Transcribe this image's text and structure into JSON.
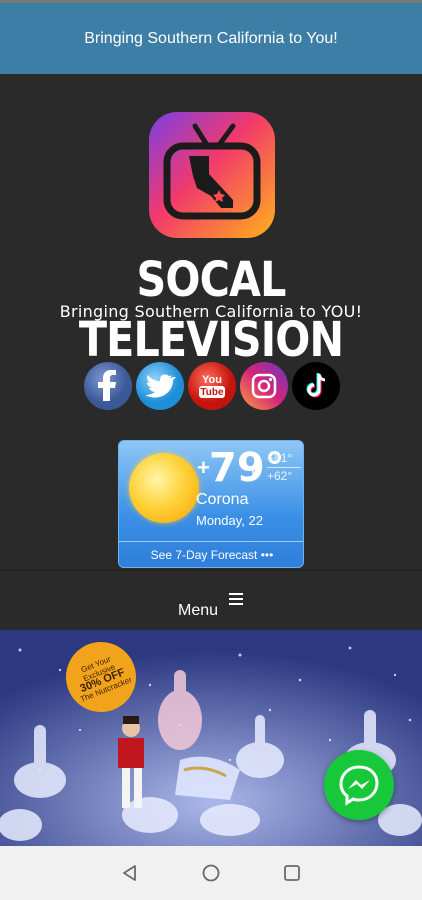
{
  "top_banner": {
    "text": "Bringing Southern California to You!"
  },
  "header": {
    "site_title": "SOCAL TELEVISION",
    "tagline": "Bringing Southern California to YOU!"
  },
  "social": [
    {
      "name": "facebook",
      "icon": "facebook-icon",
      "letter": "f",
      "color": "#3b5998"
    },
    {
      "name": "twitter",
      "icon": "twitter-icon",
      "color": "#1da1f2"
    },
    {
      "name": "youtube",
      "icon": "youtube-icon",
      "label": "You Tube",
      "color": "#e62117"
    },
    {
      "name": "instagram",
      "icon": "instagram-icon",
      "color": "#c13584"
    },
    {
      "name": "tiktok",
      "icon": "tiktok-icon",
      "color": "#000000"
    }
  ],
  "weather": {
    "plus": "+",
    "temperature": "79°",
    "unit": "F",
    "high": "+81°",
    "low": "+62°",
    "city": "Corona",
    "date": "Monday, 22",
    "forecast_link": "See 7-Day Forecast •••"
  },
  "menu": {
    "label": "Menu"
  },
  "ad": {
    "badge_line1": "Get Your",
    "badge_line2": "Exclusive",
    "badge_line3": "30% OFF",
    "badge_line4": "The Nutcracker"
  },
  "colors": {
    "banner_bg": "#3d7ea6",
    "page_bg": "#2a2a2a",
    "messenger": "#17c93a",
    "nav_bar": "#f1f1f1"
  }
}
